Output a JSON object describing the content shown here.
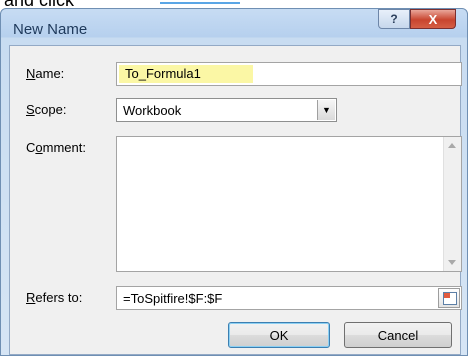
{
  "page_text": {
    "prefix": "and click"
  },
  "window": {
    "title": "New Name",
    "help_label": "?",
    "close_label": "X"
  },
  "form": {
    "name_label_u": "N",
    "name_label_rest": "ame:",
    "name_value": "To_Formula1",
    "scope_label_u": "S",
    "scope_label_rest": "cope:",
    "scope_value": "Workbook",
    "comment_label_pre": "C",
    "comment_label_u": "o",
    "comment_label_rest": "mment:",
    "comment_value": "",
    "refers_label_u": "R",
    "refers_label_rest": "efers to:",
    "refers_value": "=ToSpitfire!$F:$F"
  },
  "buttons": {
    "ok_label": "OK",
    "cancel_label": "Cancel"
  },
  "colors": {
    "name_highlight": "#fbf7a5",
    "title_bar": "#c7dcf3",
    "close_button": "#c8452f"
  }
}
